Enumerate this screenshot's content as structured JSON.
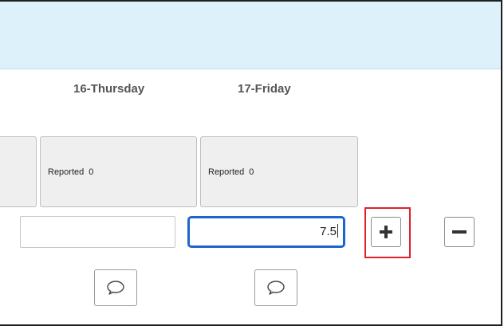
{
  "header": {
    "background": "#ddf1fb"
  },
  "days": [
    {
      "label": "16-Thursday",
      "reported_label": "Reported",
      "reported_value": "0",
      "hours_value": ""
    },
    {
      "label": "17-Friday",
      "reported_label": "Reported",
      "reported_value": "0",
      "hours_value": "7.5"
    }
  ],
  "actions": {
    "add_icon": "plus-icon",
    "remove_icon": "minus-icon",
    "comment_icon": "speech-bubble-icon"
  },
  "colors": {
    "focus_border": "#1b67c9",
    "highlight_border": "#e0202b",
    "tile_background": "#efefef"
  }
}
